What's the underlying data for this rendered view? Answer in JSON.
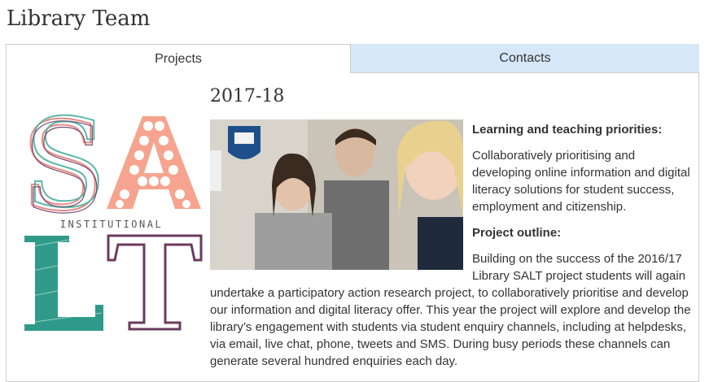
{
  "page": {
    "title": "Library Team"
  },
  "tabs": [
    {
      "label": "Projects",
      "active": true
    },
    {
      "label": "Contacts",
      "active": false
    }
  ],
  "logo": {
    "letters_top": "SA",
    "middle_word": "INSTITUTIONAL",
    "letters_bottom": "LT",
    "colors": {
      "s": "#e58b86",
      "a": "#f6a48f",
      "l": "#2f9a8a",
      "t": "#6b3a5e"
    }
  },
  "project": {
    "year": "2017-18",
    "heading1": "Learning and teaching priorities:",
    "para1": "Collaboratively prioritising and developing online information and digital literacy solutions for student success, employment and citizenship.",
    "heading2": "Project outline:",
    "para2": "Building on the success of the 2016/17 Library SALT project students will again undertake a participatory action research project, to collaboratively prioritise and develop our information and digital literacy offer. This year the project will explore and develop the library’s engagement with students via student enquiry channels, including at helpdesks, via email, live chat, phone, tweets and SMS. During busy periods these channels can generate several hundred enquiries each day."
  },
  "colors": {
    "active_tab_bg": "#ffffff",
    "inactive_tab_bg": "#d6e8f7",
    "border": "#cccccc"
  }
}
